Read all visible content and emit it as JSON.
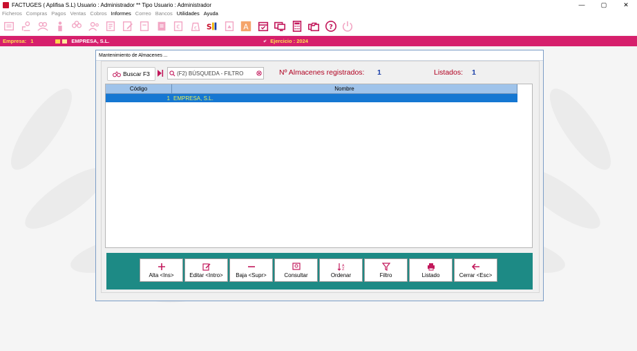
{
  "titlebar": {
    "title": "FACTUGES  ( Aplifisa S.L)   Usuario : Administrador  **  Tipo Usuario : Administrador",
    "minimize": "—",
    "maximize": "▢",
    "close": "✕"
  },
  "menu": [
    "Ficheros",
    "Compras",
    "Pagos",
    "Ventas",
    "Cobros",
    "Informes",
    "Correo",
    "Bancos",
    "Utilidades",
    "Ayuda"
  ],
  "menu_enabled": [
    false,
    false,
    false,
    false,
    false,
    true,
    false,
    false,
    true,
    true
  ],
  "toolbar_icons": [
    "fichero-icon",
    "clientes-icon",
    "usuarios-icon",
    "persona-icon",
    "grupo-icon",
    "contactos-icon",
    "documento-icon",
    "editar-icon",
    "pagina-icon",
    "archivo-icon",
    "euro-icon",
    "moneda-icon",
    "sii-icon",
    "informe-icon",
    "letra-a-icon",
    "calendario-icon",
    "monitor-icon",
    "calculadora-icon",
    "carpetas-icon",
    "ayuda-icon",
    "salir-icon"
  ],
  "companybar": {
    "empresa_label": "Empresa:",
    "empresa_num": "1",
    "empresa_name": "EMPRESA, S.L.",
    "ejercicio": "Ejercicio : 2024"
  },
  "dialog": {
    "title": "Mantenimiento de Almacenes ...",
    "search_button": "Buscar F3",
    "search_placeholder": "(F2) BÚSQUEDA - FILTRO",
    "registered_label": "Nº Almacenes registrados:",
    "registered_value": "1",
    "listed_label": "Listados:",
    "listed_value": "1",
    "columns": [
      "Código",
      "Nombre"
    ],
    "rows": [
      {
        "codigo": "1",
        "nombre": "EMPRESA, S.L."
      }
    ],
    "actions": {
      "alta": "Alta <Ins>",
      "editar": "Editar <Intro>",
      "baja": "Baja <Supr>",
      "consultar": "Consultar",
      "ordenar": "Ordenar",
      "filtro": "Filtro",
      "listado": "Listado",
      "cerrar": "Cerrar <Esc>"
    }
  },
  "colors": {
    "accent": "#d61f6c",
    "action_bar": "#1d8a85",
    "selection": "#1577d2",
    "header": "#9fc3ea"
  }
}
